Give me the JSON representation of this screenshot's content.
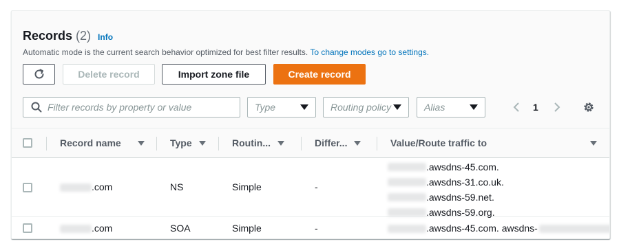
{
  "records": {
    "title": "Records",
    "count": "(2)",
    "info_label": "Info",
    "description": "Automatic mode is the current search behavior optimized for best filter results.",
    "description_link": "To change modes go to settings."
  },
  "toolbar": {
    "delete_label": "Delete record",
    "import_label": "Import zone file",
    "create_label": "Create record"
  },
  "filters": {
    "search_placeholder": "Filter records by property or value",
    "type_placeholder": "Type",
    "routing_placeholder": "Routing policy",
    "alias_placeholder": "Alias"
  },
  "pagination": {
    "current_page": "1"
  },
  "table": {
    "columns": [
      "Record name",
      "Type",
      "Routin...",
      "Differ...",
      "Value/Route traffic to"
    ],
    "rows": [
      {
        "record_name": ".com",
        "type": "NS",
        "routing": "Simple",
        "differ": "-",
        "values": [
          ".awsdns-45.com.",
          ".awsdns-31.co.uk.",
          ".awsdns-59.net.",
          ".awsdns-59.org."
        ]
      },
      {
        "record_name": ".com",
        "type": "SOA",
        "routing": "Simple",
        "differ": "-",
        "values": [
          ".awsdns-45.com. awsdns-"
        ]
      }
    ]
  },
  "colors": {
    "accent_orange": "#ec7211",
    "link_blue": "#0073bb",
    "text_dark": "#16191f",
    "border_gray": "#aab7b8"
  }
}
